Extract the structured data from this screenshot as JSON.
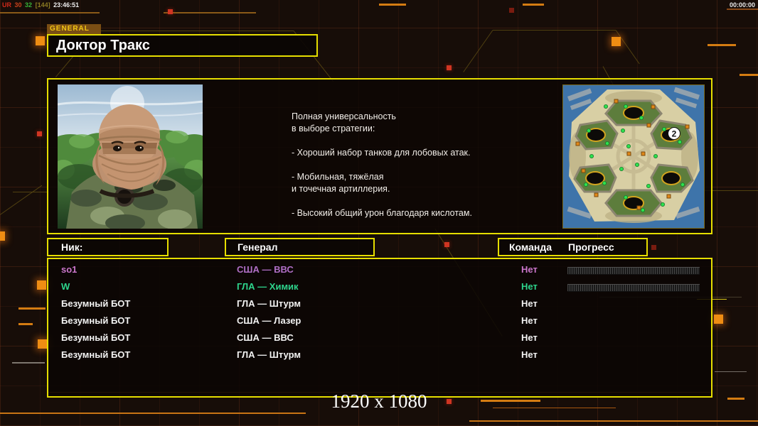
{
  "overlay": {
    "fps": {
      "ur": "UR",
      "v1": "30",
      "v2": "32",
      "v3": "[144]",
      "time": "23:46:51",
      "ur_color": "#d22a1a",
      "v1_color": "#c8421c",
      "v2_color": "#38b438",
      "v3_color": "#8a7a22",
      "time_color": "#ececec"
    },
    "clock": "00:00:00",
    "resolution": "1920 x 1080"
  },
  "colors": {
    "panel_border": "#e6de00",
    "accent_orange": "#ef8d13",
    "accent_red": "#d03522",
    "tab_bg": "#7a4e14"
  },
  "general_screen": {
    "tab_label": "GENERAL",
    "title": "Доктор Тракс",
    "description": "Полная универсальность\nв выборе стратегии:\n\n- Хороший набор танков для лобовых атак.\n\n- Мобильная, тяжёлая\nи точечная артиллерия.\n\n- Высокий общий урон благодаря кислотам.",
    "map": {
      "start_marker": "2"
    }
  },
  "lobby": {
    "headers": {
      "nick": "Ник:",
      "general": "Генерал",
      "team": "Команда",
      "progress": "Прогресс"
    },
    "players": [
      {
        "nick": "so1",
        "general": "США — ВВС",
        "team": "Нет",
        "color": "#cb76cb",
        "general_color": "#b06fc6",
        "has_progress": true
      },
      {
        "nick": "W",
        "general": "ГЛА — Химик",
        "team": "Нет",
        "color": "#2ed48c",
        "general_color": "#2ed48c",
        "has_progress": true
      },
      {
        "nick": "Безумный БОТ",
        "general": "ГЛА — Штурм",
        "team": "Нет",
        "color": "#f2f2f2",
        "general_color": "#f2f2f2",
        "has_progress": false
      },
      {
        "nick": "Безумный БОТ",
        "general": "США — Лазер",
        "team": "Нет",
        "color": "#f2f2f2",
        "general_color": "#f2f2f2",
        "has_progress": false
      },
      {
        "nick": "Безумный БОТ",
        "general": "США — ВВС",
        "team": "Нет",
        "color": "#f2f2f2",
        "general_color": "#f2f2f2",
        "has_progress": false
      },
      {
        "nick": "Безумный БОТ",
        "general": "ГЛА — Штурм",
        "team": "Нет",
        "color": "#f2f2f2",
        "general_color": "#f2f2f2",
        "has_progress": false
      }
    ]
  }
}
